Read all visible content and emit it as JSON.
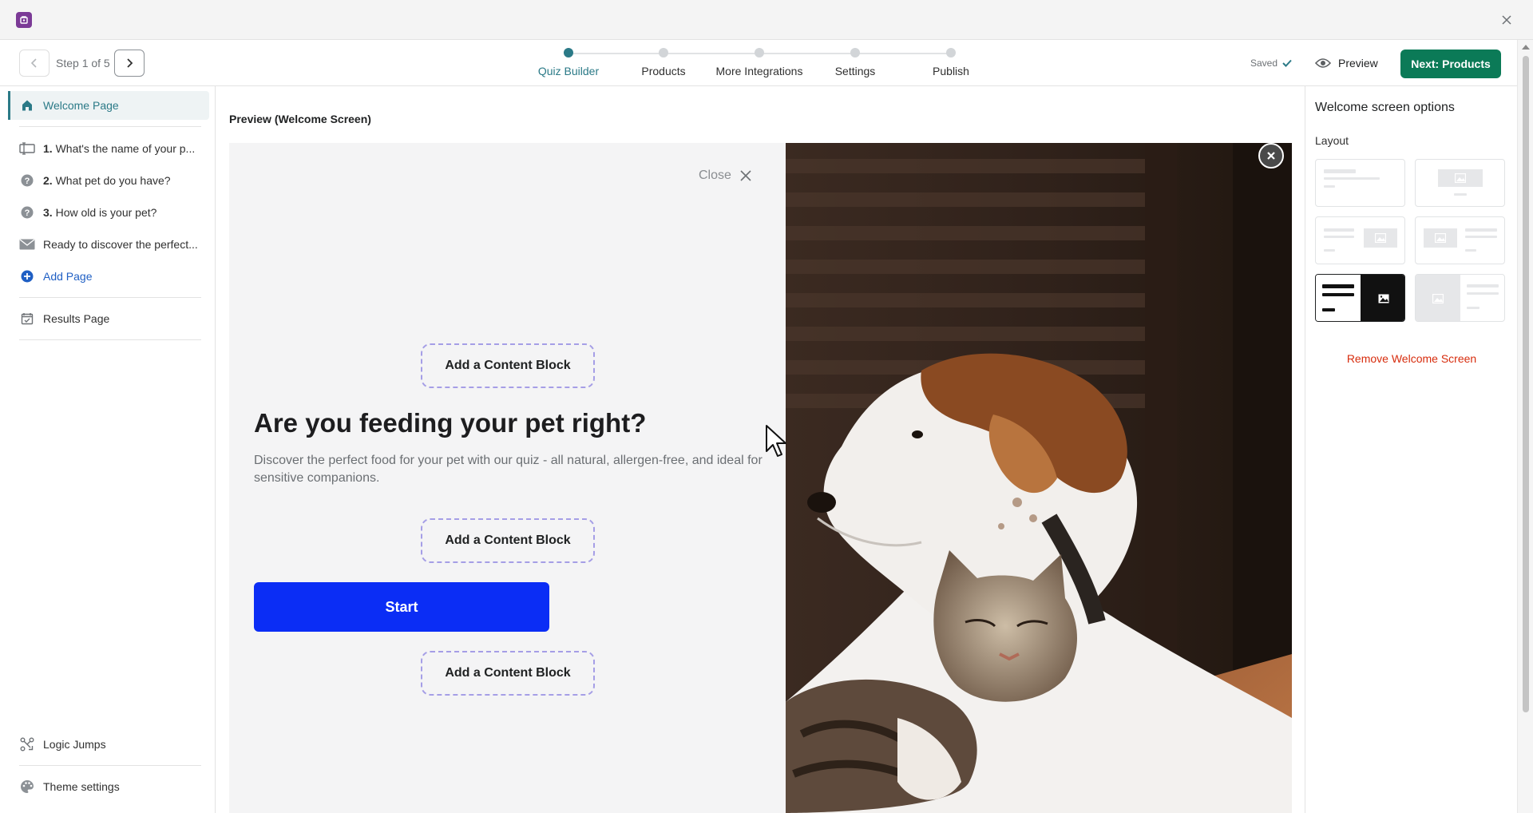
{
  "window": {
    "close_label": "×"
  },
  "topbar": {
    "step_label": "Step 1 of 5",
    "steps": [
      {
        "label": "Quiz Builder",
        "active": true
      },
      {
        "label": "Products",
        "active": false
      },
      {
        "label": "More Integrations",
        "active": false
      },
      {
        "label": "Settings",
        "active": false
      },
      {
        "label": "Publish",
        "active": false
      }
    ],
    "saved_label": "Saved",
    "preview_label": "Preview",
    "next_label": "Next: Products"
  },
  "sidebar": {
    "welcome": "Welcome Page",
    "questions": [
      {
        "num": "1.",
        "text": "What's the name of your p..."
      },
      {
        "num": "2.",
        "text": "What pet do you have?"
      },
      {
        "num": "3.",
        "text": "How old is your pet?"
      }
    ],
    "email_page": "Ready to discover the perfect...",
    "add_page": "Add Page",
    "results": "Results Page",
    "logic_jumps": "Logic Jumps",
    "theme_settings": "Theme settings"
  },
  "main": {
    "title": "Preview (Welcome Screen)",
    "close_label": "Close",
    "content_block_label": "Add a Content Block",
    "headline": "Are you feeding your pet right?",
    "description": "Discover the perfect food for your pet with our quiz - all natural, allergen-free, and ideal for sensitive companions.",
    "start_label": "Start"
  },
  "right_panel": {
    "title": "Welcome screen options",
    "layout_label": "Layout",
    "remove_label": "Remove Welcome Screen"
  },
  "colors": {
    "accent": "#2b7a87",
    "primary_button": "#0b7a57",
    "start_button": "#0b2df5",
    "danger": "#d72c0d"
  }
}
